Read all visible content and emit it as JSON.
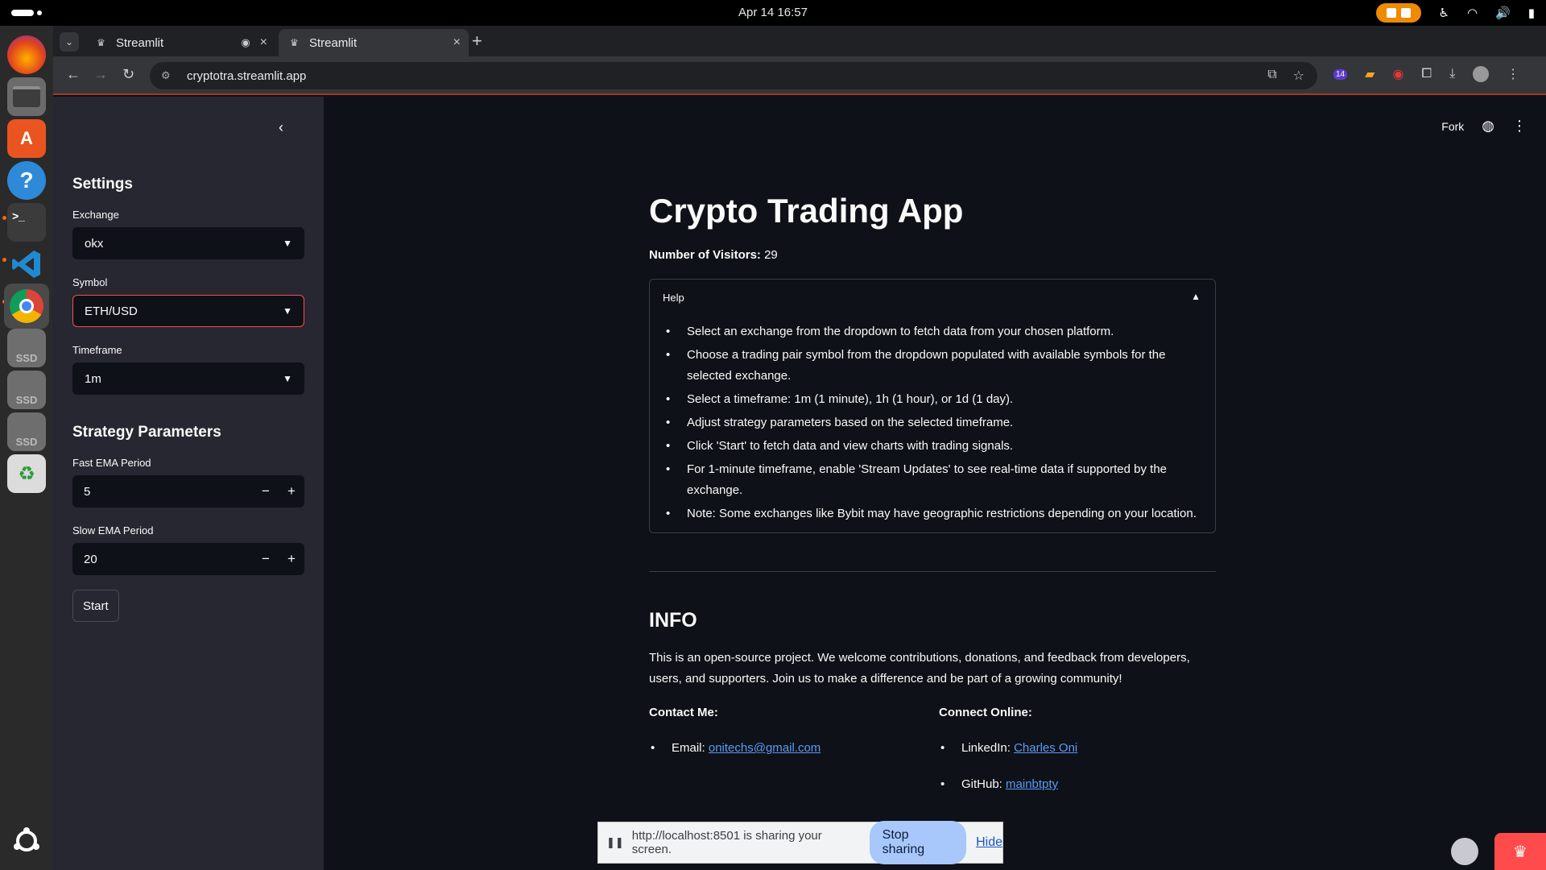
{
  "system": {
    "clock": "Apr 14  16:57",
    "tray_icons": [
      "accessibility-icon",
      "wifi-icon",
      "volume-icon",
      "battery-icon"
    ]
  },
  "dock": {
    "apps": [
      "firefox",
      "files",
      "app-center",
      "help",
      "terminal",
      "vscode",
      "chrome",
      "ssd-drive",
      "ssd-drive",
      "ssd-drive",
      "trash",
      "ubuntu-logo"
    ],
    "ssd_label": "SSD"
  },
  "browser": {
    "tabs": [
      {
        "label": "Streamlit",
        "active": false
      },
      {
        "label": "Streamlit",
        "active": true
      }
    ],
    "url": "cryptotra.streamlit.app",
    "extension_badge": "14"
  },
  "sidebar": {
    "settings_heading": "Settings",
    "exchange_label": "Exchange",
    "exchange_value": "okx",
    "symbol_label": "Symbol",
    "symbol_value": "ETH/USD",
    "timeframe_label": "Timeframe",
    "timeframe_value": "1m",
    "strategy_heading": "Strategy Parameters",
    "fast_ema_label": "Fast EMA Period",
    "fast_ema_value": "5",
    "slow_ema_label": "Slow EMA Period",
    "slow_ema_value": "20",
    "start_label": "Start"
  },
  "header": {
    "fork_label": "Fork"
  },
  "main": {
    "title": "Crypto Trading App",
    "visitors_label": "Number of Visitors:",
    "visitors_value": "29",
    "help": {
      "label": "Help",
      "items": [
        "Select an exchange from the dropdown to fetch data from your chosen platform.",
        "Choose a trading pair symbol from the dropdown populated with available symbols for the selected exchange.",
        "Select a timeframe: 1m (1 minute), 1h (1 hour), or 1d (1 day).",
        "Adjust strategy parameters based on the selected timeframe.",
        "Click 'Start' to fetch data and view charts with trading signals.",
        "For 1-minute timeframe, enable 'Stream Updates' to see real-time data if supported by the exchange.",
        "Note: Some exchanges like Bybit may have geographic restrictions depending on your location."
      ]
    },
    "info_heading": "INFO",
    "info_text": "This is an open-source project. We welcome contributions, donations, and feedback from developers, users, and supporters. Join us to make a difference and be part of a growing community!",
    "contact_heading": "Contact Me:",
    "email_label": "Email:",
    "email_value": "onitechs@gmail.com",
    "connect_heading": "Connect Online:",
    "linkedin_label": "LinkedIn:",
    "linkedin_value": "Charles Oni",
    "github_label": "GitHub:",
    "github_value": "mainbtpty"
  },
  "share_bar": {
    "message": "http://localhost:8501 is sharing your screen.",
    "stop_label": "Stop sharing",
    "hide_label": "Hide"
  },
  "colors": {
    "accent": "#ff4b4b",
    "background": "#0e1117",
    "sidebar": "#262730",
    "link": "#5a9cf8"
  }
}
